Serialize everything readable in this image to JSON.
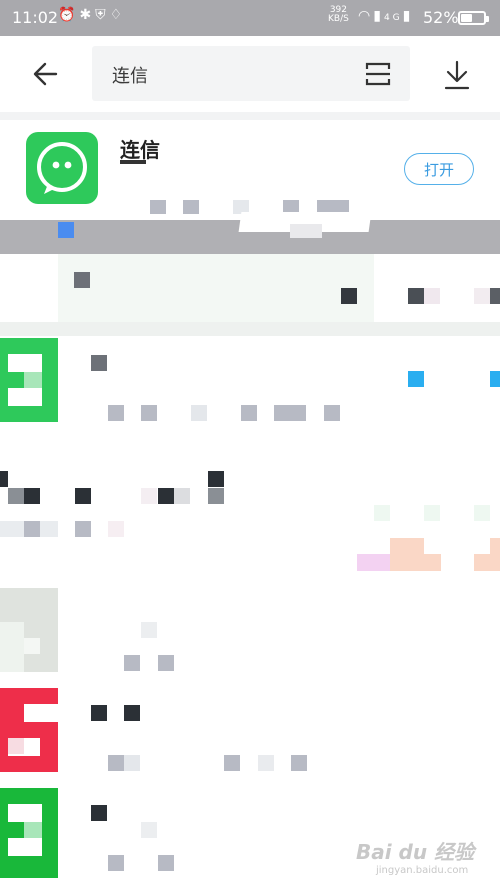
{
  "status_bar": {
    "time": "11:02",
    "net_speed_value": "392",
    "net_speed_unit": "KB/S",
    "signal_label": "4G",
    "battery_percent": "52%",
    "battery_level": 0.52,
    "icons": [
      "alarm-icon",
      "bluetooth-icon",
      "shield-icon",
      "qq-icon",
      "wifi-icon",
      "signal-icon",
      "battery-icon"
    ]
  },
  "search": {
    "back_icon": "back-arrow-icon",
    "query": "连信",
    "scan_icon": "scan-icon",
    "download_icon": "download-icon"
  },
  "app": {
    "name": "连信",
    "icon": "chat-bubble-icon",
    "icon_color": "#2ec95b",
    "open_button_label": "打开",
    "accent_color": "#3a9be0"
  },
  "watermark": {
    "text": "Bai du 经验",
    "subtext": "jingyan.baidu.com"
  }
}
